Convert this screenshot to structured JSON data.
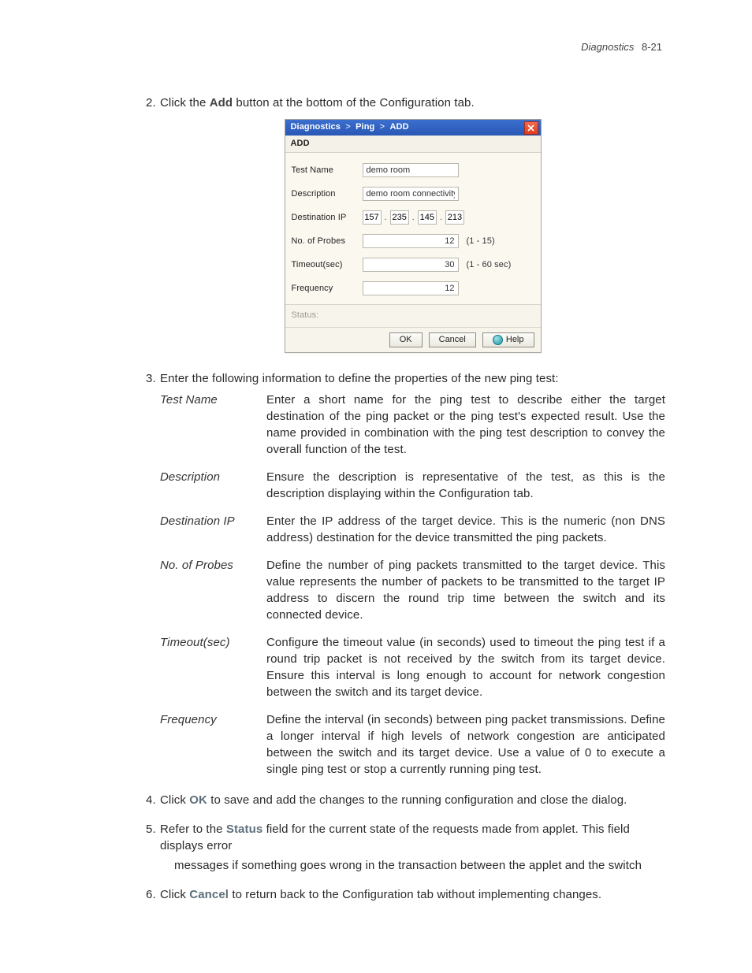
{
  "header": {
    "section": "Diagnostics",
    "page": "8-21"
  },
  "step2": {
    "pre": "Click the ",
    "bold": "Add",
    "post": " button at the bottom of the Configuration tab."
  },
  "dialog": {
    "crumb1": "Diagnostics",
    "crumb2": "Ping",
    "crumb3": "ADD",
    "subhead": "ADD",
    "labels": {
      "test_name": "Test Name",
      "description": "Description",
      "dest_ip": "Destination IP",
      "probes": "No. of Probes",
      "timeout": "Timeout(sec)",
      "frequency": "Frequency",
      "status": "Status:"
    },
    "values": {
      "test_name": "demo room",
      "description": "demo room connectivity",
      "ip": {
        "o1": "157",
        "o2": "235",
        "o3": "145",
        "o4": "213"
      },
      "probes": "12",
      "timeout": "30",
      "frequency": "12"
    },
    "hints": {
      "probes": "(1 - 15)",
      "timeout": "(1 - 60 sec)"
    },
    "buttons": {
      "ok": "OK",
      "cancel": "Cancel",
      "help": "Help"
    }
  },
  "step3": {
    "text": "Enter the following information to define the properties of the new ping test:"
  },
  "defs": [
    {
      "term": "Test Name",
      "desc": "Enter a short name for the ping test to describe either the target destination of the ping packet or the ping test's expected result. Use the name provided in combination with the ping test description to convey the overall function of the test."
    },
    {
      "term": "Description",
      "desc": "Ensure the description is representative of the test, as this is the description displaying within the Configuration tab."
    },
    {
      "term": "Destination IP",
      "desc": "Enter the IP address of the target device. This is the numeric (non DNS address) destination for the device transmitted the ping packets."
    },
    {
      "term": "No. of Probes",
      "desc": "Define the number of ping packets transmitted to the target device. This value represents the number of packets to be transmitted to the target IP address to discern the round trip time between the switch and its connected device."
    },
    {
      "term": "Timeout(sec)",
      "desc": "Configure the timeout value (in seconds) used to timeout the ping test if a round trip packet is not received by the switch from its target device. Ensure this interval is long enough to account for network congestion between the switch and its target device."
    },
    {
      "term": "Frequency",
      "desc": "Define the interval (in seconds) between ping packet transmissions. Define a longer interval if high levels of network congestion are anticipated between the switch and its target device. Use a value of 0 to execute a single ping test or stop a currently running ping test."
    }
  ],
  "step4": {
    "pre": "Click ",
    "bold": "OK",
    "post": " to save and add the changes to the running configuration and close the dialog."
  },
  "step5": {
    "pre": "Refer to the ",
    "bold": "Status",
    "post": " field for the current state of the requests made from applet. This field displays error",
    "line2": "messages if something goes wrong in the transaction between the applet and the switch"
  },
  "step6": {
    "pre": "Click ",
    "bold": "Cancel",
    "post": " to return back to the Configuration tab without implementing changes."
  }
}
